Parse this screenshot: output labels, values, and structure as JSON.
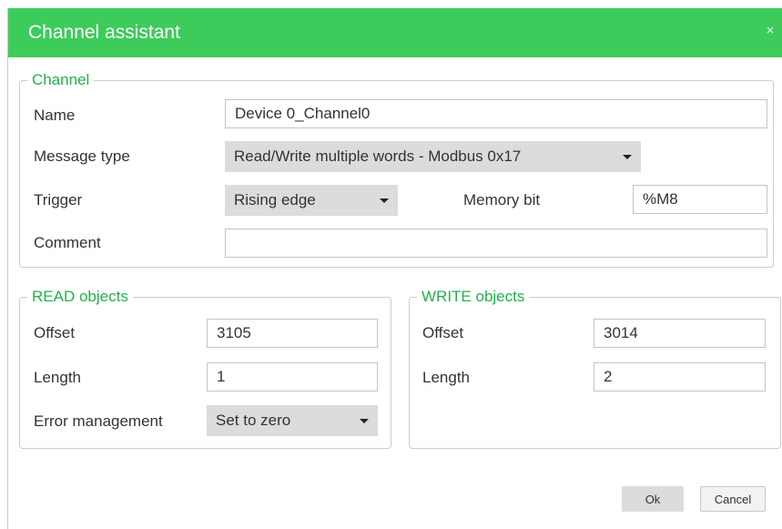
{
  "dialog": {
    "title": "Channel assistant",
    "close_glyph": "×",
    "close_icon": "close-icon"
  },
  "channel": {
    "legend": "Channel",
    "name_label": "Name",
    "name_value": "Device 0_Channel0",
    "message_type_label": "Message type",
    "message_type_value": "Read/Write multiple words - Modbus 0x17",
    "trigger_label": "Trigger",
    "trigger_value": "Rising edge",
    "memory_bit_label": "Memory bit",
    "memory_bit_value": "%M8",
    "comment_label": "Comment",
    "comment_value": ""
  },
  "read_objects": {
    "legend": "READ objects",
    "offset_label": "Offset",
    "offset_value": "3105",
    "length_label": "Length",
    "length_value": "1",
    "error_label": "Error management",
    "error_value": "Set to zero"
  },
  "write_objects": {
    "legend": "WRITE objects",
    "offset_label": "Offset",
    "offset_value": "3014",
    "length_label": "Length",
    "length_value": "2"
  },
  "buttons": {
    "ok": "Ok",
    "cancel": "Cancel"
  },
  "colors": {
    "title_bar": "#3dcc5c",
    "legend_text": "#22b14c",
    "select_bg": "#dcdcdc"
  }
}
